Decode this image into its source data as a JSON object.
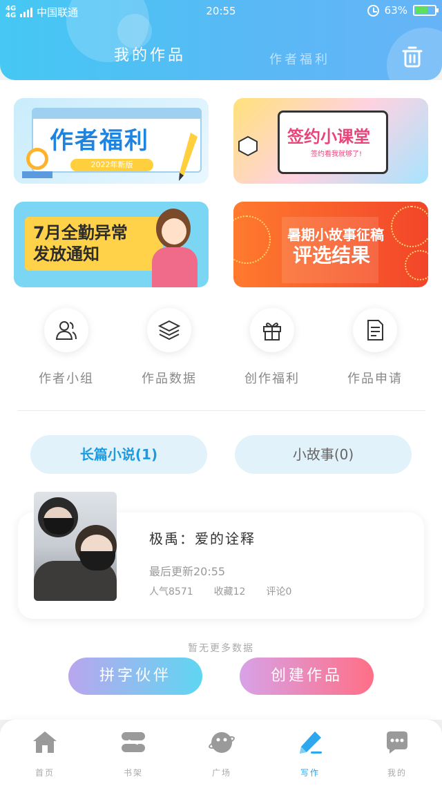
{
  "statusbar": {
    "network_top": "4G",
    "network_bottom": "4G",
    "carrier": "中国联通",
    "time": "20:55",
    "battery": "63%"
  },
  "header": {
    "tab_active": "我的作品",
    "tab_inactive": "作者福利",
    "colors": {
      "primary": "#45c8f3",
      "accent": "#2da7ee"
    }
  },
  "banners": [
    {
      "title": "作者福利",
      "subtitle": "2022年新版"
    },
    {
      "title": "签约小课堂",
      "subtitle": "签约看我就够了!"
    },
    {
      "title_line1": "7月全勤异常",
      "title_line2": "发放通知"
    },
    {
      "title_line1": "暑期小故事征稿",
      "title_line2": "评选结果"
    }
  ],
  "features": [
    {
      "icon": "users-icon",
      "label": "作者小组"
    },
    {
      "icon": "layers-icon",
      "label": "作品数据"
    },
    {
      "icon": "gift-icon",
      "label": "创作福利"
    },
    {
      "icon": "document-icon",
      "label": "作品申请"
    }
  ],
  "categories": {
    "long": "长篇小说(1)",
    "short": "小故事(0)"
  },
  "work": {
    "title": "极禹：爱的诠释",
    "updated": "最后更新20:55",
    "stats": {
      "popularity": "人气8571",
      "favorites": "收藏12",
      "comments": "评论0"
    }
  },
  "no_more": "暂无更多数据",
  "actions": {
    "partner": "拼字伙伴",
    "create": "创建作品"
  },
  "nav": [
    {
      "icon": "home-icon",
      "label": "首页"
    },
    {
      "icon": "bookshelf-icon",
      "label": "书架"
    },
    {
      "icon": "plaza-icon",
      "label": "广场"
    },
    {
      "icon": "pen-icon",
      "label": "写作",
      "active": true
    },
    {
      "icon": "message-icon",
      "label": "我的"
    }
  ]
}
